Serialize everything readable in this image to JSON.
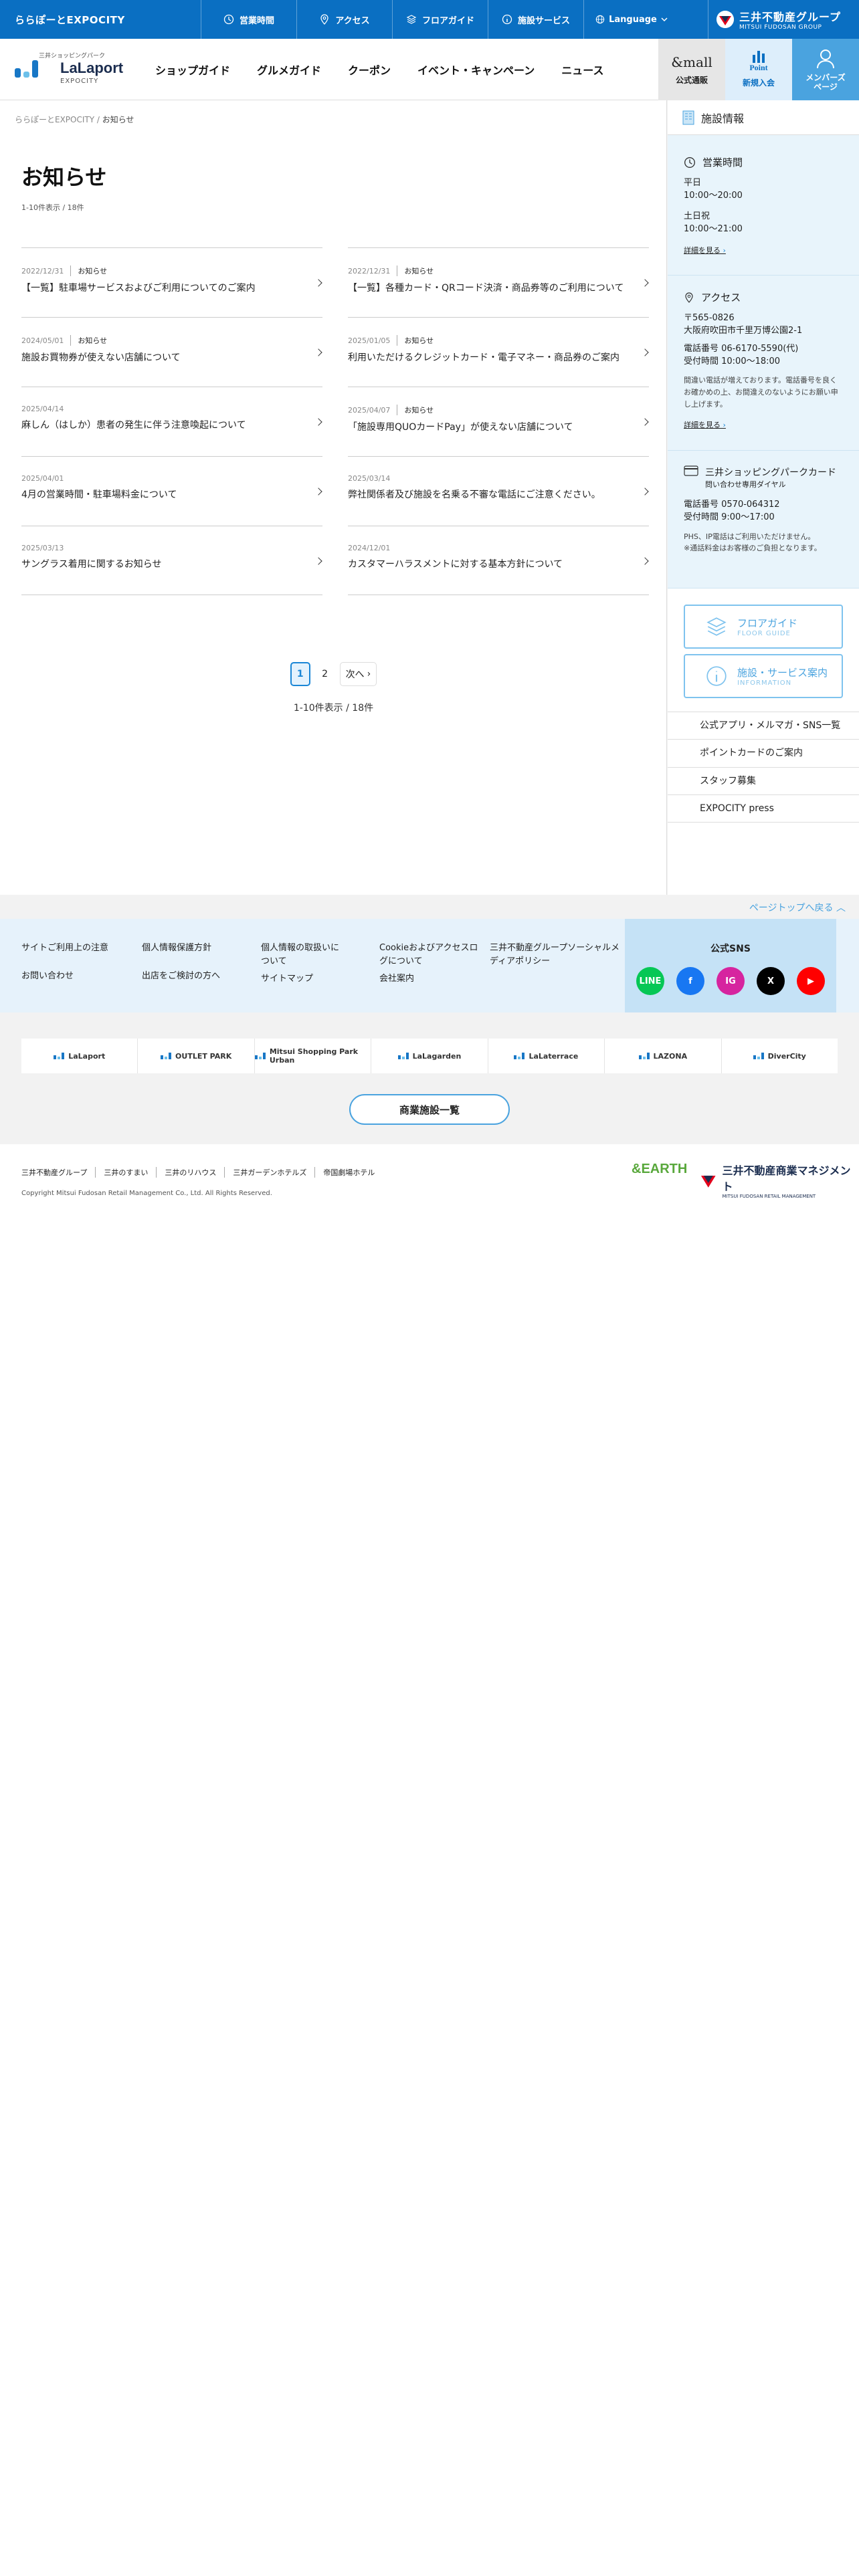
{
  "topbar": {
    "site_label": "ららぽーとEXPOCITY",
    "links": [
      {
        "label": "営業時間",
        "icon": "clock-icon"
      },
      {
        "label": "アクセス",
        "icon": "pin-icon"
      },
      {
        "label": "フロアガイド",
        "icon": "layers-icon"
      },
      {
        "label": "施設サービス",
        "icon": "info-icon"
      }
    ],
    "language_label": "Language",
    "group_name": "三井不動産グループ",
    "group_name_en": "MITSUI FUDOSAN GROUP"
  },
  "header": {
    "logo_sub": "三井ショッピングパーク",
    "logo_name": "LaLaport",
    "logo_site": "EXPOCITY",
    "nav": [
      "ショップガイド",
      "グルメガイド",
      "クーポン",
      "イベント・キャンペーン",
      "ニュース"
    ],
    "mall_logo": "&mall",
    "mall_label": "公式通販",
    "point_logo": "Point",
    "point_label": "新規入会",
    "member_label": "メンバーズページ"
  },
  "breadcrumb": {
    "home": "ららぽーとEXPOCITY",
    "sep": "/",
    "current": "お知らせ"
  },
  "page": {
    "title": "お知らせ",
    "count_top": "1-10件表示 / 18件",
    "count_bottom": "1-10件表示 / 18件"
  },
  "news": [
    {
      "date": "2022/12/31",
      "category": "お知らせ",
      "title": "【一覧】駐車場サービスおよびご利用についてのご案内"
    },
    {
      "date": "2022/12/31",
      "category": "お知らせ",
      "title": "【一覧】各種カード・QRコード決済・商品券等のご利用について"
    },
    {
      "date": "2024/05/01",
      "category": "お知らせ",
      "title": "施設お買物券が使えない店舗について"
    },
    {
      "date": "2025/01/05",
      "category": "お知らせ",
      "title": "利用いただけるクレジットカード・電子マネー・商品券のご案内"
    },
    {
      "date": "2025/04/14",
      "category": "",
      "title": "麻しん（はしか）患者の発生に伴う注意喚起について"
    },
    {
      "date": "2025/04/07",
      "category": "お知らせ",
      "title": "「施設専用QUOカードPay」が使えない店舗について"
    },
    {
      "date": "2025/04/01",
      "category": "",
      "title": "4月の営業時間・駐車場料金について"
    },
    {
      "date": "2025/03/14",
      "category": "",
      "title": "弊社関係者及び施設を名乗る不審な電話にご注意ください。"
    },
    {
      "date": "2025/03/13",
      "category": "",
      "title": "サングラス着用に関するお知らせ"
    },
    {
      "date": "2024/12/01",
      "category": "",
      "title": "カスタマーハラスメントに対する基本方針について"
    }
  ],
  "pager": {
    "page1": "1",
    "page2": "2",
    "next": "次へ"
  },
  "sidebar": {
    "title": "施設情報",
    "hours": {
      "title": "営業時間",
      "weekday_label": "平日",
      "weekday_time": "10:00〜20:00",
      "weekend_label": "土日祝",
      "weekend_time": "10:00〜21:00",
      "more": "詳細を見る"
    },
    "access": {
      "title": "アクセス",
      "zip": "〒565-0826",
      "address": "大阪府吹田市千里万博公園2-1",
      "tel": "電話番号 06-6170-5590(代)",
      "reception": "受付時間 10:00〜18:00",
      "note": "間違い電話が増えております。電話番号を良くお確かめの上、お間違えのないようにお願い申し上げます。",
      "more": "詳細を見る"
    },
    "card": {
      "title": "三井ショッピングパークカード",
      "subtitle": "問い合わせ専用ダイヤル",
      "tel": "電話番号 0570-064312",
      "reception": "受付時間 9:00〜17:00",
      "note1": "PHS、IP電話はご利用いただけません。",
      "note2": "※通話料金はお客様のご負担となります。"
    },
    "floor_btn": {
      "label": "フロアガイド",
      "sub": "FLOOR GUIDE"
    },
    "info_btn": {
      "label": "施設・サービス案内",
      "sub": "INFORMATION"
    },
    "links": [
      "公式アプリ・メルマガ・SNS一覧",
      "ポイントカードのご案内",
      "スタッフ募集",
      "EXPOCITY press"
    ]
  },
  "pagetop": "ページトップへ戻る",
  "footer_nav": {
    "col1": [
      "サイトご利用上の注意",
      "お問い合わせ"
    ],
    "col2": [
      "個人情報保護方針",
      "出店をご検討の方へ"
    ],
    "col3": [
      "個人情報の取扱いについて",
      "サイトマップ"
    ],
    "col4": [
      "Cookieおよびアクセスログについて",
      "会社案内"
    ],
    "col5": [
      "三井不動産グループソーシャルメディアポリシー"
    ]
  },
  "sns": {
    "title": "公式SNS",
    "items": [
      {
        "name": "LINE",
        "color": "#06c755"
      },
      {
        "name": "f",
        "color": "#1877f2"
      },
      {
        "name": "IG",
        "color": "#d6249f"
      },
      {
        "name": "X",
        "color": "#000000"
      },
      {
        "name": "▶",
        "color": "#ff0000"
      }
    ]
  },
  "banners": [
    "LaLaport",
    "OUTLET PARK",
    "Mitsui Shopping Park Urban",
    "LaLagarden",
    "LaLaterrace",
    "LAZONA",
    "DiverCity"
  ],
  "all_facilities": "商業施設一覧",
  "footer": {
    "links": [
      "三井不動産グループ",
      "三井のすまい",
      "三井のリハウス",
      "三井ガーデンホテルズ",
      "帝国劇場ホテル"
    ],
    "copyright": "Copyright Mitsui Fudosan Retail Management Co., Ltd. All Rights Reserved.",
    "logo_earth": "&EARTH",
    "logo_mfrm": "三井不動産商業マネジメント",
    "logo_mfrm_en": "MITSUI FUDOSAN RETAIL MANAGEMENT"
  },
  "colors": {
    "brand_blue": "#0a6fc2",
    "accent_light": "#4aa3df",
    "panel_bg": "#e8f4fb"
  }
}
